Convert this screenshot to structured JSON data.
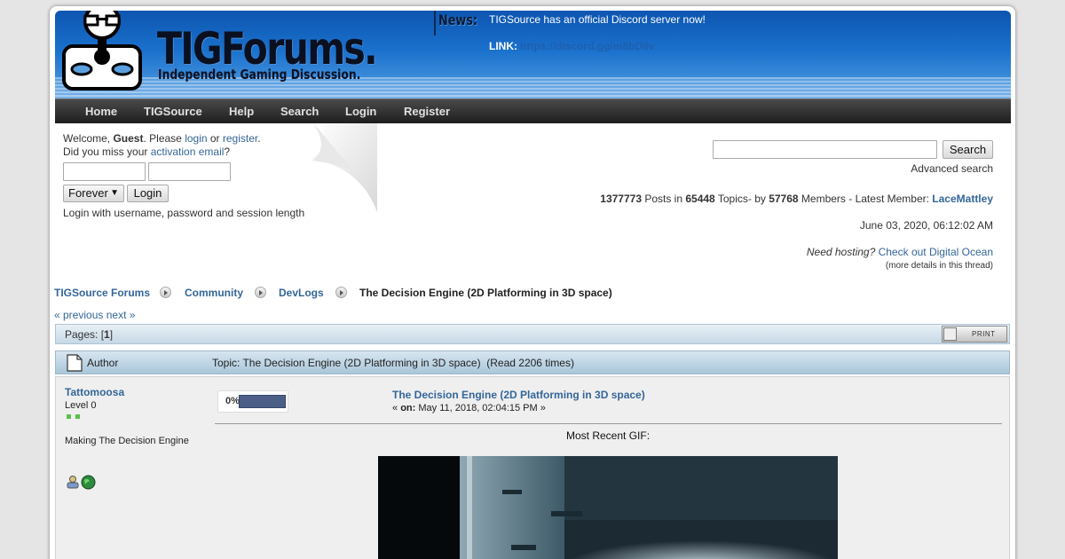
{
  "header": {
    "logo_title": "TIGForums.",
    "logo_subtitle": "Independent Gaming Discussion.",
    "news_label": "News:",
    "news_text": "TIGSource has an official Discord server now!",
    "news_link_label": "LINK:",
    "news_link": "https://discord.gg/m8bD8v"
  },
  "menu": {
    "items": [
      "Home",
      "TIGSource",
      "Help",
      "Search",
      "Login",
      "Register"
    ]
  },
  "userbox": {
    "welcome": "Welcome, ",
    "guest": "Guest",
    "please": ". Please ",
    "login_link": "login",
    "or": " or ",
    "register_link": "register",
    "period": ".",
    "missed": "Did you miss your ",
    "activation_link": "activation email",
    "question": "?",
    "session_option": "Forever",
    "login_button": "Login",
    "hint": "Login with username, password and session length"
  },
  "search": {
    "button": "Search",
    "advanced": "Advanced search"
  },
  "stats": {
    "posts": "1377773",
    "posts_label": " Posts in ",
    "topics": "65448",
    "topics_label": " Topics- by ",
    "members": "57768",
    "members_label": " Members - Latest Member: ",
    "latest_member": "LaceMattley",
    "date": "June 03, 2020, 06:12:02 AM",
    "hosting_q": "Need hosting?",
    "hosting_link": "Check out Digital Ocean",
    "details_link": "(more details in this thread)"
  },
  "breadcrumb": {
    "items": [
      "TIGSource Forums",
      "Community",
      "DevLogs",
      "The Decision Engine (2D Platforming in 3D space)"
    ]
  },
  "nav": {
    "previous": "« previous",
    "next": "next »"
  },
  "pages": {
    "label": "Pages: [",
    "current": "1",
    "close": "]",
    "print": "PRINT"
  },
  "topic": {
    "author_label": "Author",
    "title_line": "Topic: The Decision Engine (2D Platforming in 3D space)  (Read 2206 times)"
  },
  "post": {
    "author": "Tattomoosa",
    "level": "Level 0",
    "personal_text": "Making The Decision Engine",
    "progress_text": "0%",
    "title": "The Decision Engine (2D Platforming in 3D space)",
    "on_prefix": "« ",
    "on_label": "on:",
    "date": " May 11, 2018, 02:04:15 PM »",
    "body_heading": "Most Recent GIF:"
  },
  "colors": {
    "link": "#346699",
    "header_blue": "#1a71cc",
    "menu_dark": "#1e1e1e",
    "title_bar": "#c7d9e6"
  }
}
